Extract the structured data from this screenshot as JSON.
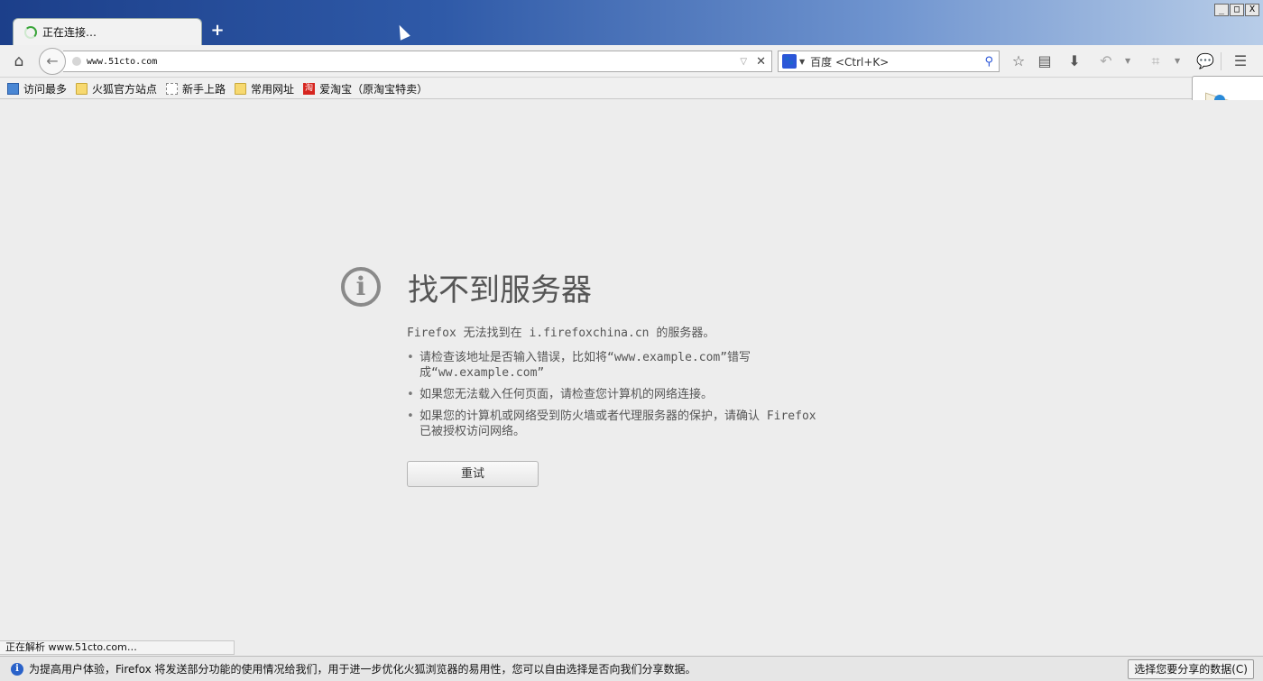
{
  "window": {
    "controls": {
      "minimize": "_",
      "maximize": "□",
      "close": "X"
    }
  },
  "tab": {
    "title": "正在连接…",
    "new_tab_label": "+"
  },
  "navbar": {
    "url": "www.51cto.com",
    "search_placeholder": "百度 <Ctrl+K>",
    "search_engine_icon": "baidu-paw-icon",
    "search_engine_glyph": "🐾"
  },
  "bookmarks": [
    {
      "label": "访问最多",
      "icon": "most-visited-icon"
    },
    {
      "label": "火狐官方站点",
      "icon": "folder-icon"
    },
    {
      "label": "新手上路",
      "icon": "dashed-page-icon"
    },
    {
      "label": "常用网址",
      "icon": "folder-icon"
    },
    {
      "label": "爱淘宝（原淘宝特卖）",
      "icon": "taobao-icon",
      "glyph": "淘"
    }
  ],
  "error_page": {
    "title": "找不到服务器",
    "description": "Firefox 无法找到在 i.firefoxchina.cn 的服务器。",
    "suggestions": [
      "请检查该地址是否输入错误，比如将“www.example.com”错写成“ww.example.com”",
      "如果您无法载入任何页面，请检查您计算机的网络连接。",
      "如果您的计算机或网络受到防火墙或者代理服务器的保护，请确认 Firefox 已被授权访问网络。"
    ],
    "retry_label": "重试"
  },
  "status": {
    "text": "正在解析 www.51cto.com…"
  },
  "notification": {
    "text": "为提高用户体验，Firefox 将发送部分功能的使用情况给我们，用于进一步优化火狐浏览器的易用性，您可以自由选择是否向我们分享数据。",
    "button_label": "选择您要分享的数据(C)"
  }
}
